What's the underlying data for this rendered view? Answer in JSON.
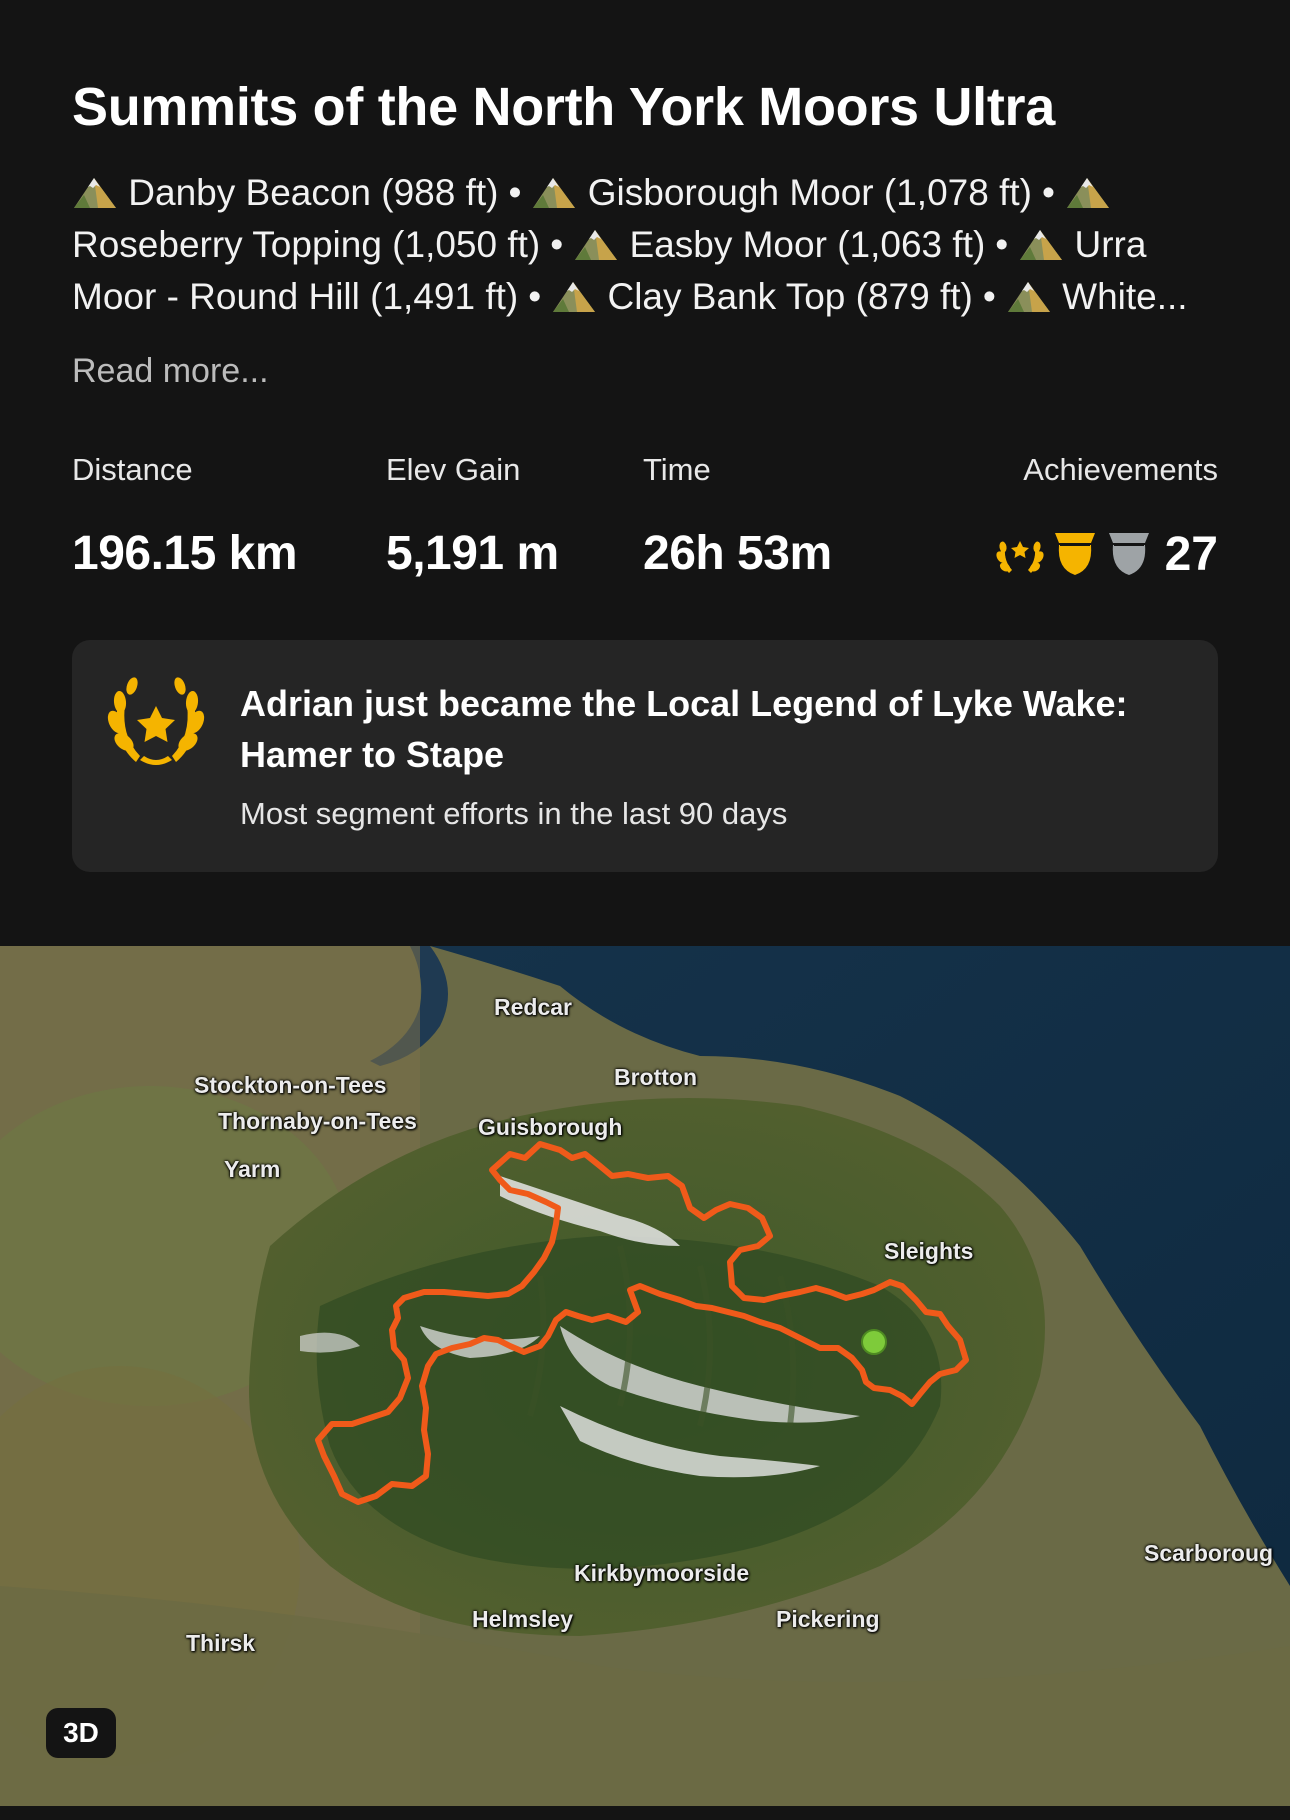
{
  "activity": {
    "title": "Summits of the North York Moors Ultra",
    "summits": [
      "Danby Beacon (988 ft)",
      "Gisborough Moor (1,078 ft)",
      "Roseberry Topping (1,050 ft)",
      "Easby Moor (1,063 ft)",
      "Urra Moor - Round Hill (1,491 ft)",
      "Clay Bank Top (879 ft)",
      "White..."
    ],
    "summit_icon": "mountain-peak-icon",
    "separator": "•",
    "read_more": "Read more..."
  },
  "stats": {
    "distance": {
      "label": "Distance",
      "value": "196.15 km"
    },
    "elev_gain": {
      "label": "Elev Gain",
      "value": "5,191 m"
    },
    "time": {
      "label": "Time",
      "value": "26h 53m"
    },
    "achievements": {
      "label": "Achievements",
      "count": "27",
      "icons": [
        "laurel-wreath-icon",
        "gold-trophy-icon",
        "silver-trophy-icon"
      ]
    }
  },
  "legend_card": {
    "icon": "laurel-wreath-icon",
    "title": "Adrian just became the Local Legend of Lyke Wake: Hamer to Stape",
    "subtitle": "Most segment efforts in the last 90 days"
  },
  "map": {
    "view_toggle": "3D",
    "route_color": "#f05a1a",
    "start_marker_color": "#7ecb3a",
    "places": {
      "redcar": "Redcar",
      "brotton": "Brotton",
      "stockton": "Stockton-on-Tees",
      "thornaby": "Thornaby-on-Tees",
      "guisborough": "Guisborough",
      "yarm": "Yarm",
      "sleights": "Sleights",
      "kirkbymoorside": "Kirkbymoorside",
      "helmsley": "Helmsley",
      "pickering": "Pickering",
      "thirsk": "Thirsk",
      "scarborough": "Scarboroug"
    }
  },
  "colors": {
    "background": "#141414",
    "card": "#252525",
    "gold": "#f5b400",
    "silver": "#9ea3a6"
  }
}
